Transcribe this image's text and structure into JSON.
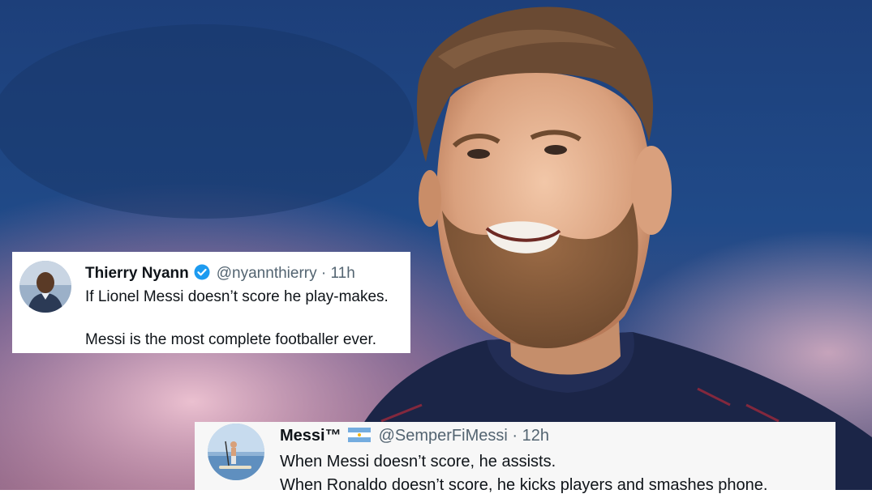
{
  "tweets": [
    {
      "name": "Thierry Nyann",
      "handle": "@nyannthierry",
      "time": "· 11h",
      "lines": [
        "If Lionel Messi doesn’t score he play-makes.",
        "Messi is the most complete footballer ever."
      ]
    },
    {
      "name": "Messi™",
      "handle": "@SemperFiMessi",
      "time": "· 12h",
      "lines": [
        "When Messi doesn’t score, he assists.",
        "When Ronaldo doesn’t score, he kicks players and smashes phone."
      ]
    }
  ],
  "colors": {
    "stadium_blue": "#1e3c72",
    "jersey_navy": "#1b2547",
    "verified_blue": "#1d9bf0",
    "handle_gray": "#536471"
  }
}
